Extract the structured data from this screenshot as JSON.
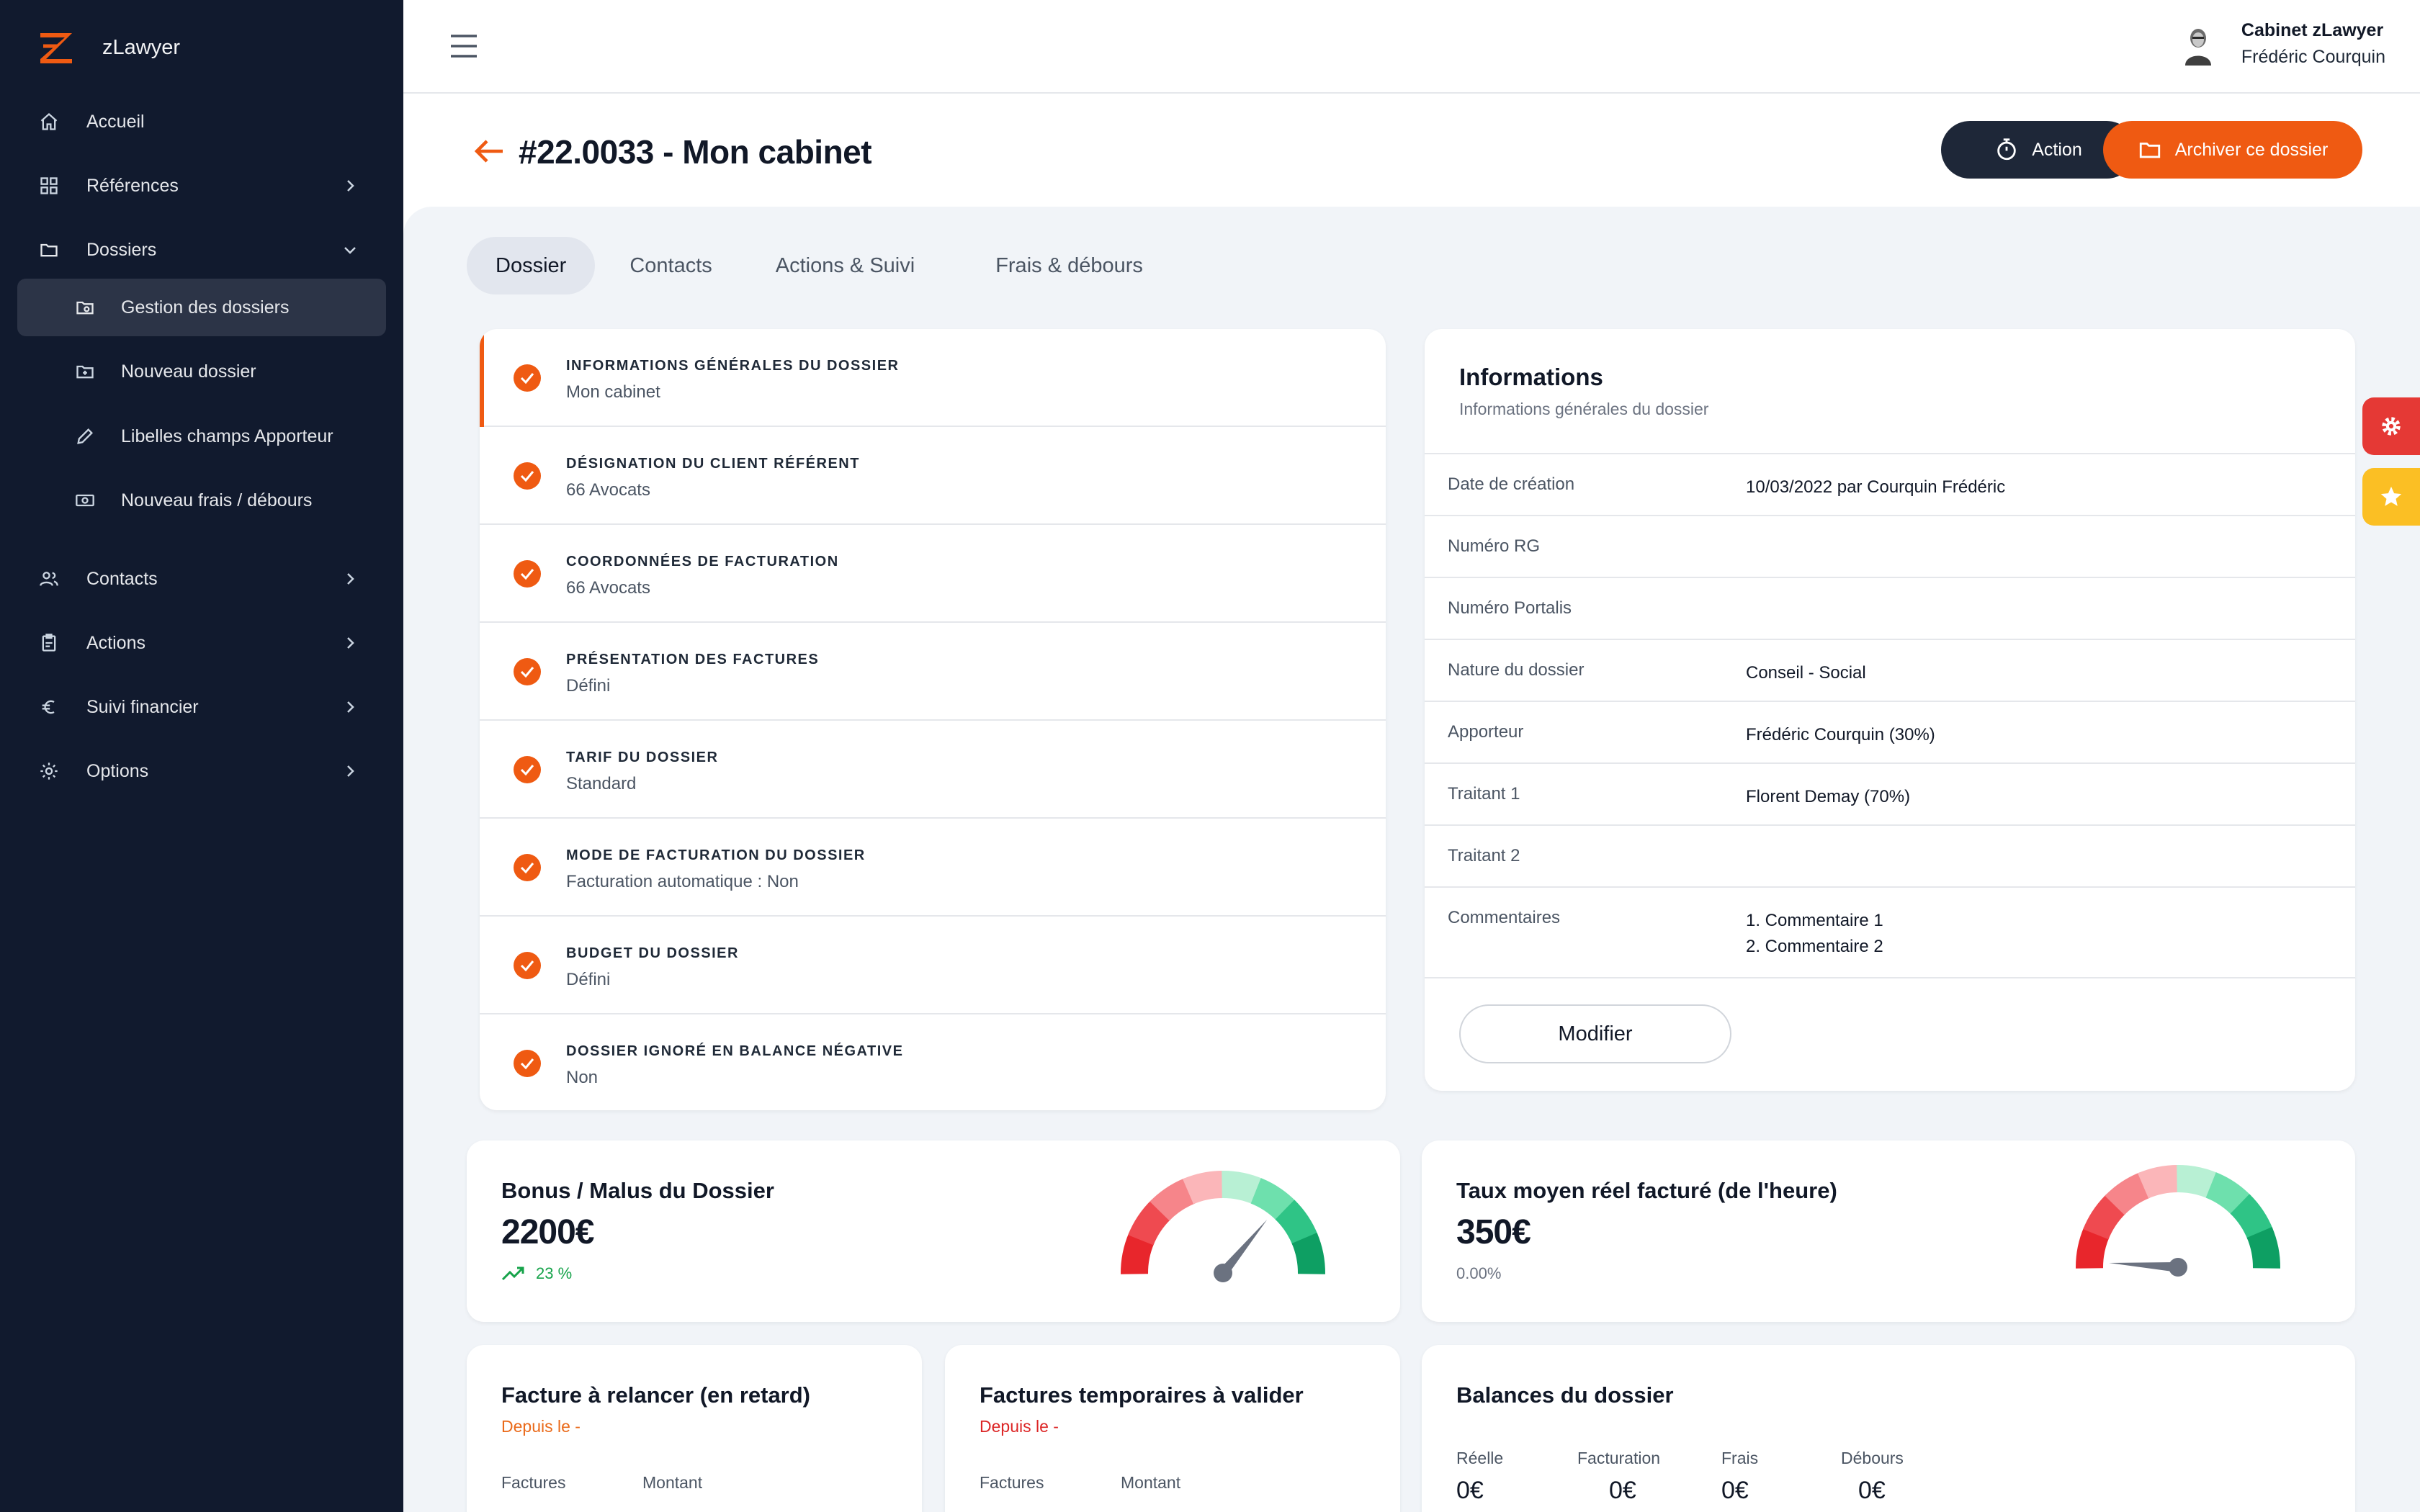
{
  "app": {
    "name": "zLawyer"
  },
  "sidebar": {
    "items": [
      {
        "label": "Accueil",
        "icon": "home-icon"
      },
      {
        "label": "Références",
        "icon": "grid-icon"
      },
      {
        "label": "Dossiers",
        "icon": "folder-icon"
      },
      {
        "label": "Gestion des dossiers",
        "icon": "folder-manage-icon"
      },
      {
        "label": "Nouveau dossier",
        "icon": "folder-plus-icon"
      },
      {
        "label": "Libelles champs Apporteur",
        "icon": "pencil-icon"
      },
      {
        "label": "Nouveau frais / débours",
        "icon": "money-icon"
      },
      {
        "label": "Contacts",
        "icon": "users-icon"
      },
      {
        "label": "Actions",
        "icon": "clipboard-icon"
      },
      {
        "label": "Suivi financier",
        "icon": "euro-icon"
      },
      {
        "label": "Options",
        "icon": "gear-icon"
      }
    ]
  },
  "header": {
    "org": "Cabinet zLawyer",
    "user": "Frédéric Courquin"
  },
  "page": {
    "title": "#22.0033 - Mon cabinet",
    "action_label": "Action",
    "archive_label": "Archiver ce dossier"
  },
  "tabs": [
    {
      "label": "Dossier"
    },
    {
      "label": "Contacts"
    },
    {
      "label": "Actions & Suivi"
    },
    {
      "label": "Frais & débours"
    }
  ],
  "steps": [
    {
      "title": "INFORMATIONS GÉNÉRALES DU DOSSIER",
      "value": "Mon cabinet"
    },
    {
      "title": "DÉSIGNATION DU CLIENT RÉFÉRENT",
      "value": "66 Avocats"
    },
    {
      "title": "COORDONNÉES DE FACTURATION",
      "value": "66 Avocats"
    },
    {
      "title": "PRÉSENTATION DES FACTURES",
      "value": "Défini"
    },
    {
      "title": "TARIF DU DOSSIER",
      "value": "Standard"
    },
    {
      "title": "MODE DE FACTURATION DU DOSSIER",
      "value": "Facturation automatique : Non"
    },
    {
      "title": "BUDGET DU DOSSIER",
      "value": "Défini"
    },
    {
      "title": "DOSSIER IGNORÉ EN BALANCE NÉGATIVE",
      "value": "Non"
    }
  ],
  "info": {
    "title": "Informations",
    "subtitle": "Informations générales du dossier",
    "rows": [
      {
        "label": "Date de création",
        "value": "10/03/2022 par Courquin Frédéric"
      },
      {
        "label": "Numéro RG",
        "value": ""
      },
      {
        "label": "Numéro Portalis",
        "value": ""
      },
      {
        "label": "Nature du dossier",
        "value": "Conseil - Social"
      },
      {
        "label": "Apporteur",
        "value": "Frédéric Courquin (30%)"
      },
      {
        "label": "Traitant 1",
        "value": "Florent Demay (70%)"
      },
      {
        "label": "Traitant 2",
        "value": ""
      },
      {
        "label": "Commentaires",
        "value": "1. Commentaire 1",
        "value2": "2. Commentaire 2"
      }
    ],
    "modify_label": "Modifier"
  },
  "kpis": [
    {
      "title": "Bonus / Malus du Dossier",
      "value": "2200€",
      "sub": "23 %",
      "gauge_level": 0.72
    },
    {
      "title": "Taux moyen réel facturé (de l'heure)",
      "value": "350€",
      "sub": "0.00%",
      "gauge_level": 0.02
    }
  ],
  "bottom": {
    "relancer": {
      "title": "Facture à relancer (en retard)",
      "sub": "Depuis le -",
      "col1": "Factures",
      "col2": "Montant"
    },
    "temporaires": {
      "title": "Factures temporaires à valider",
      "sub": "Depuis le -",
      "col1": "Factures",
      "col2": "Montant"
    },
    "balances": {
      "title": "Balances du dossier",
      "cols": [
        {
          "label": "Réelle",
          "value": "0€"
        },
        {
          "label": "Facturation",
          "value": "0€"
        },
        {
          "label": "Frais",
          "value": "0€"
        },
        {
          "label": "Débours",
          "value": "0€"
        }
      ]
    }
  },
  "colors": {
    "accent": "#ef5a12",
    "sidebar": "#111a2e",
    "dark_button": "#1e2738",
    "float_red": "#e53935",
    "float_yellow": "#fbbf24"
  }
}
